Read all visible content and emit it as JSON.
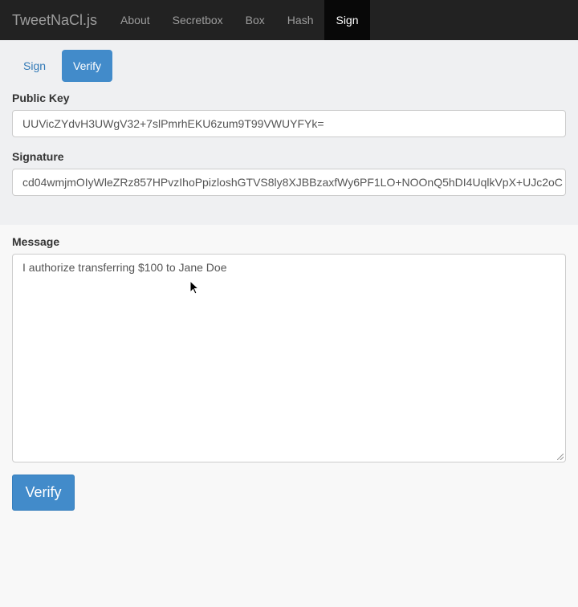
{
  "navbar": {
    "brand": "TweetNaCl.js",
    "items": [
      {
        "label": "About"
      },
      {
        "label": "Secretbox"
      },
      {
        "label": "Box"
      },
      {
        "label": "Hash"
      },
      {
        "label": "Sign"
      }
    ],
    "active": "Sign"
  },
  "tabs": {
    "sign_label": "Sign",
    "verify_label": "Verify",
    "active": "Verify"
  },
  "public_key": {
    "label": "Public Key",
    "value": "UUVicZYdvH3UWgV32+7slPmrhEKU6zum9T99VWUYFYk="
  },
  "signature": {
    "label": "Signature",
    "value": "cd04wmjmOIyWleZRz857HPvzIhoPpizloshGTVS8ly8XJBBzaxfWy6PF1LO+NOOnQ5hDI4UqlkVpX+UJc2oC"
  },
  "message": {
    "label": "Message",
    "value": "I authorize transferring $100 to Jane Doe"
  },
  "verify_button": {
    "label": "Verify"
  },
  "colors": {
    "navbar_bg": "#222222",
    "active_nav_bg": "#080808",
    "accent": "#428bca"
  }
}
